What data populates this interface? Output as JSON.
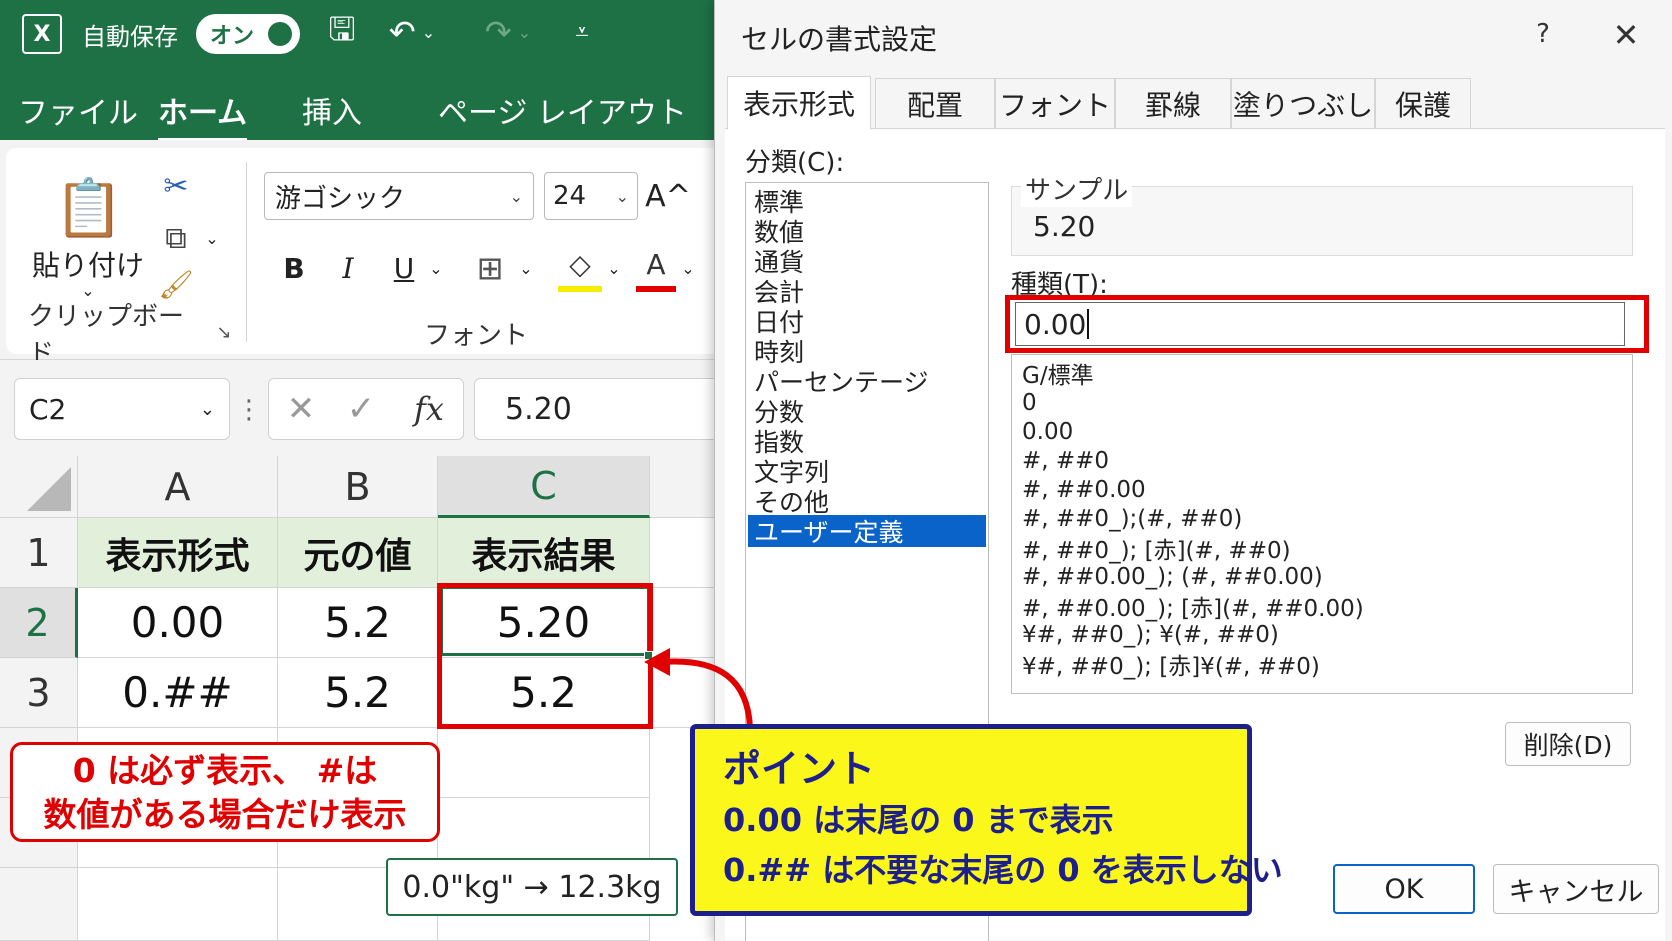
{
  "titlebar": {
    "autosave_label": "自動保存",
    "autosave_state": "オン"
  },
  "ribbon_tabs": [
    "ファイル",
    "ホーム",
    "挿入",
    "ページ レイアウト"
  ],
  "ribbon": {
    "paste_label": "貼り付け",
    "clipboard_group": "クリップボード",
    "font_name": "游ゴシック",
    "font_size": "24",
    "font_group": "フォント",
    "bold": "B",
    "italic": "I",
    "underline": "U",
    "font_color_letter": "A",
    "grow_font": "A^",
    "fill_color": "#f6ed00",
    "font_color": "#e00000"
  },
  "formula_bar": {
    "name_box": "C2",
    "fx": "fx",
    "value": "5.20"
  },
  "grid": {
    "columns": [
      "A",
      "B",
      "C"
    ],
    "rows": [
      "1",
      "2",
      "3"
    ],
    "header_row": [
      "表示形式",
      "元の値",
      "表示結果"
    ],
    "row2": [
      "0.00",
      "5.2",
      "5.20"
    ],
    "row3": [
      "0.##",
      "5.2",
      "5.2"
    ],
    "active_cell": "C2"
  },
  "notes": {
    "red_line1": "0 は必ず表示、 #は",
    "red_line2": "数値がある場合だけ表示",
    "kg_example": "0.0\"kg\" → 12.3kg"
  },
  "point": {
    "title": "ポイント",
    "line1": "0.00 は末尾の 0 まで表示",
    "line2": "0.## は不要な末尾の 0 を表示しない"
  },
  "dialog": {
    "title": "セルの書式設定",
    "help": "?",
    "tabs": [
      "表示形式",
      "配置",
      "フォント",
      "罫線",
      "塗りつぶし",
      "保護"
    ],
    "category_label": "分類(C):",
    "categories": [
      "標準",
      "数値",
      "通貨",
      "会計",
      "日付",
      "時刻",
      "パーセンテージ",
      "分数",
      "指数",
      "文字列",
      "その他",
      "ユーザー定義"
    ],
    "selected_category": "ユーザー定義",
    "sample_label": "サンプル",
    "sample_value": "5.20",
    "type_label": "種類(T):",
    "type_value": "0.00",
    "formats": [
      "G/標準",
      "0",
      "0.00",
      "#, ##0",
      "#, ##0.00",
      "#, ##0_);(#, ##0)",
      "#, ##0_); [赤](#, ##0)",
      "#, ##0.00_); (#, ##0.00)",
      "#, ##0.00_); [赤](#, ##0.00)",
      "¥#, ##0_); ¥(#, ##0)",
      "¥#, ##0_); [赤]¥(#, ##0)"
    ],
    "delete_label": "削除(D)",
    "ok_label": "OK",
    "cancel_label": "キャンセル"
  },
  "colors": {
    "excel_green": "#1e7145",
    "highlight_red": "#e00000",
    "point_yellow": "#fbf71a",
    "point_navy": "#1c1f8c",
    "selection_blue": "#0a63c9"
  }
}
